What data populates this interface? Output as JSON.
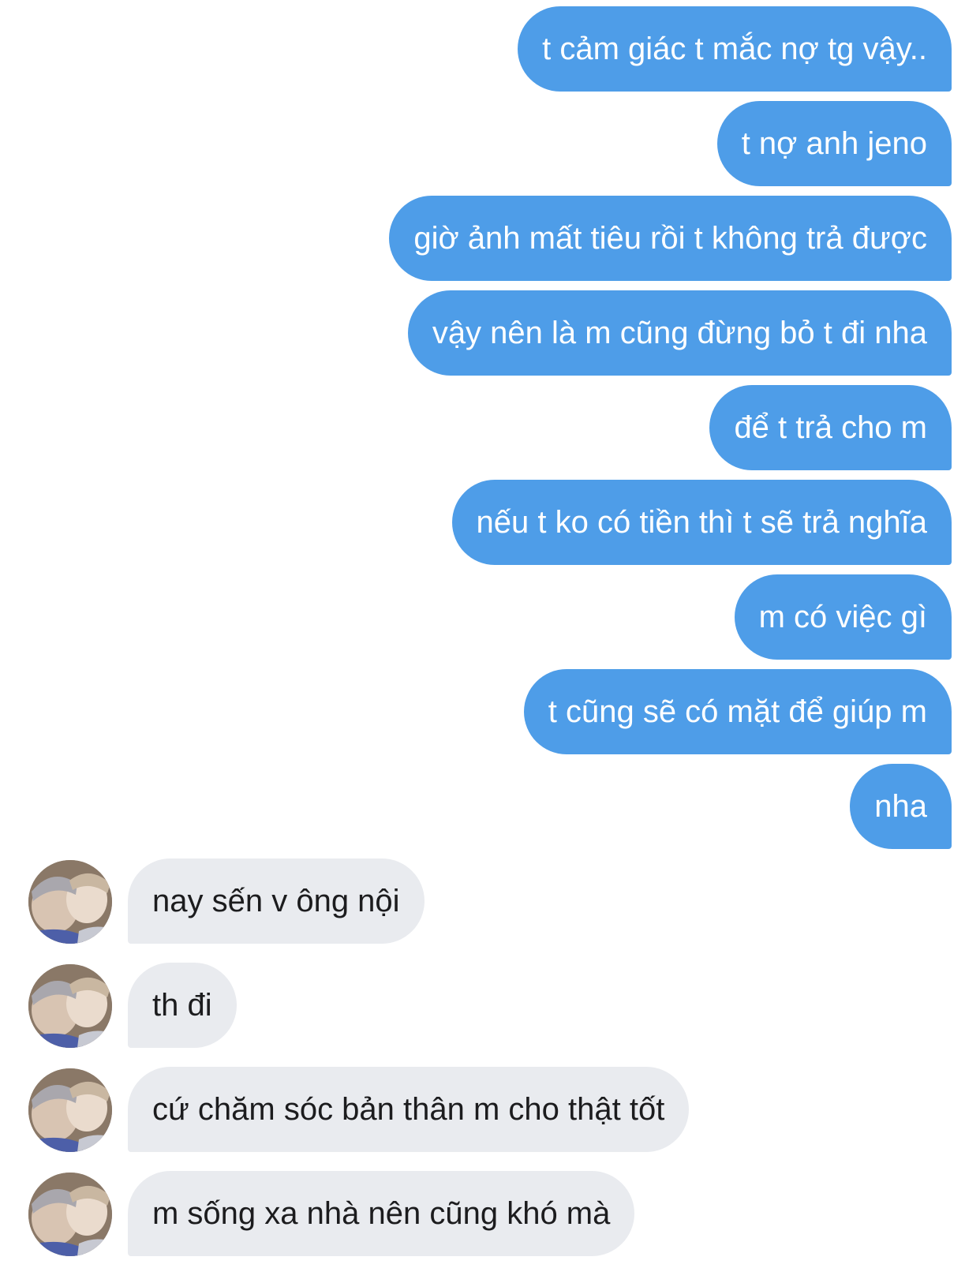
{
  "conversation": {
    "outgoing": [
      {
        "text": "t cảm giác t mắc nợ tg vậy.."
      },
      {
        "text": "t nợ anh jeno"
      },
      {
        "text": "giờ ảnh mất tiêu rồi t không trả được"
      },
      {
        "text": "vậy nên là m cũng đừng bỏ t đi nha"
      },
      {
        "text": "để t trả cho m"
      },
      {
        "text": "nếu t ko có tiền thì t sẽ trả nghĩa"
      },
      {
        "text": "m có việc gì"
      },
      {
        "text": "t cũng sẽ có mặt để giúp m"
      },
      {
        "text": "nha"
      }
    ],
    "incoming": [
      {
        "text": "nay sến v ông nội"
      },
      {
        "text": "th đi"
      },
      {
        "text": "cứ chăm sóc bản thân m cho thật tốt"
      },
      {
        "text": "m sống xa nhà nên cũng khó mà"
      }
    ]
  },
  "colors": {
    "outgoing_bubble": "#4e9de8",
    "incoming_bubble": "#e9ebef",
    "outgoing_text": "#ffffff",
    "incoming_text": "#1c1c1e"
  },
  "icons": {
    "avatar": "contact-avatar-photo"
  }
}
